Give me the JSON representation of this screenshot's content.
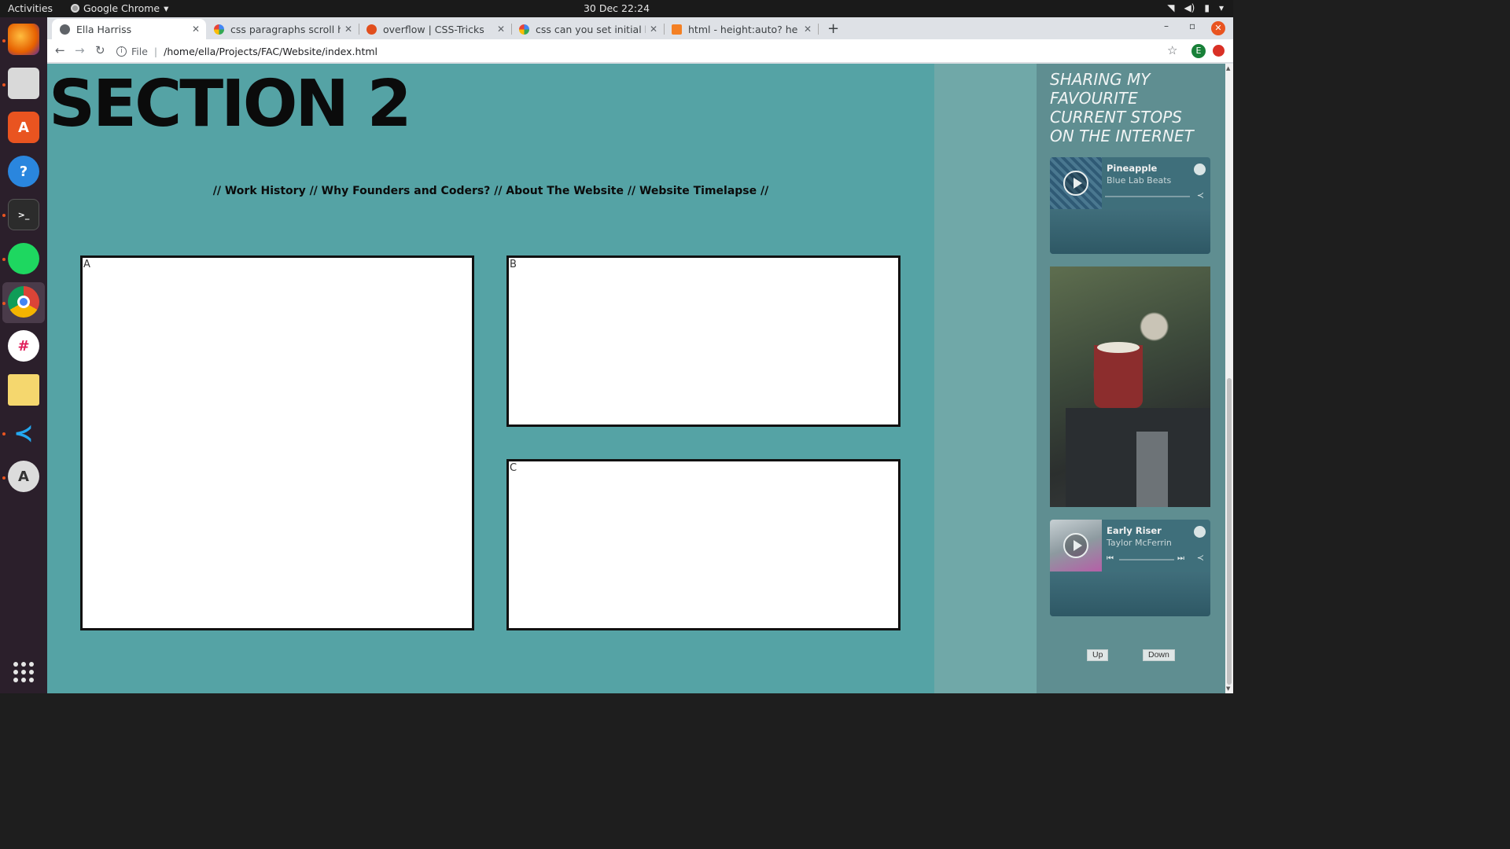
{
  "system": {
    "activities": "Activities",
    "app_name": "Google Chrome",
    "clock": "30 Dec  22:24"
  },
  "dock": {
    "apps": [
      "firefox-icon",
      "files-icon",
      "app-store-icon",
      "help-icon",
      "terminal-icon",
      "spotify-icon",
      "chrome-icon",
      "slack-icon",
      "notes-icon",
      "vscode-icon",
      "software-updater-icon"
    ]
  },
  "tabs": [
    {
      "label": "Ella Harriss",
      "active": true
    },
    {
      "label": "css paragraphs scroll hidde",
      "active": false
    },
    {
      "label": "overflow | CSS-Tricks",
      "active": false
    },
    {
      "label": "css can you set initial heigh",
      "active": false
    },
    {
      "label": "html - height:auto? height",
      "active": false
    }
  ],
  "address": {
    "scheme_label": "File",
    "url": "/home/ella/Projects/FAC/Website/index.html"
  },
  "profile_initial": "E",
  "page": {
    "section_title": "SECTION 2",
    "subnav": "// Work History // Why Founders and Coders? // About The Website // Website Timelapse //",
    "boxes": [
      {
        "label": "A"
      },
      {
        "label": "B"
      },
      {
        "label": "C"
      }
    ]
  },
  "sidebar": {
    "title": "SHARING MY FAVOURITE CURRENT STOPS ON THE INTERNET",
    "players": [
      {
        "title": "Pineapple",
        "artist": "Blue Lab Beats"
      },
      {
        "title": "Early Riser",
        "artist": "Taylor McFerrin"
      }
    ],
    "up_label": "Up",
    "down_label": "Down"
  },
  "colors": {
    "page_bg": "#55a3a5",
    "sidebar_bg": "#5f8e91",
    "accent": "#e95420"
  }
}
